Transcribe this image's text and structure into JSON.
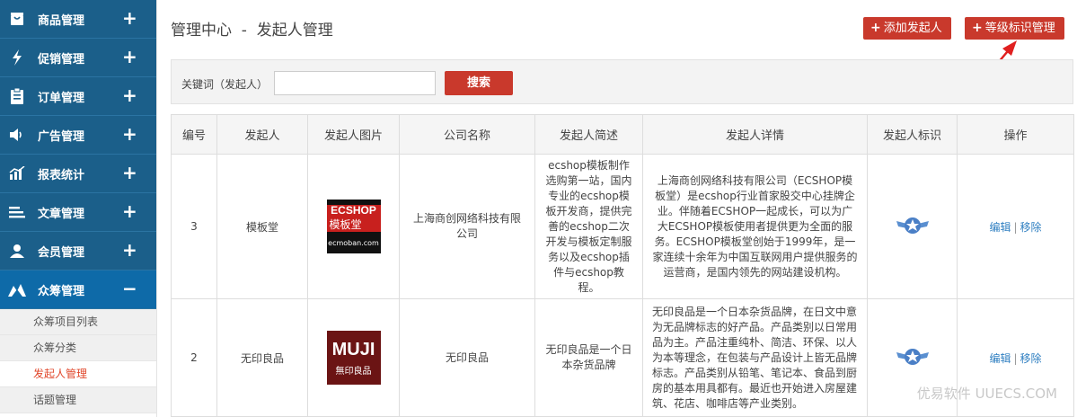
{
  "sidebar": {
    "items": [
      {
        "label": "商品管理",
        "icon": "shopping-bag-icon",
        "toggle": "+"
      },
      {
        "label": "促销管理",
        "icon": "lightning-icon",
        "toggle": "+"
      },
      {
        "label": "订单管理",
        "icon": "clipboard-icon",
        "toggle": "+"
      },
      {
        "label": "广告管理",
        "icon": "speaker-icon",
        "toggle": "+"
      },
      {
        "label": "报表统计",
        "icon": "chart-icon",
        "toggle": "+"
      },
      {
        "label": "文章管理",
        "icon": "list-icon",
        "toggle": "+"
      },
      {
        "label": "会员管理",
        "icon": "user-icon",
        "toggle": "+"
      },
      {
        "label": "众筹管理",
        "icon": "crowdfunding-icon",
        "toggle": "−"
      }
    ],
    "sub_items": [
      {
        "label": "众筹项目列表"
      },
      {
        "label": "众筹分类"
      },
      {
        "label": "发起人管理"
      },
      {
        "label": "话题管理"
      }
    ]
  },
  "header": {
    "title": "管理中心  -  发起人管理",
    "add_btn": "添加发起人",
    "level_btn": "等级标识管理"
  },
  "search": {
    "label": "关键词（发起人）",
    "value": "",
    "placeholder": "",
    "button": "搜索"
  },
  "table": {
    "headers": [
      "编号",
      "发起人",
      "发起人图片",
      "公司名称",
      "发起人简述",
      "发起人详情",
      "发起人标识",
      "操作"
    ],
    "rows": [
      {
        "id": "3",
        "name": "模板堂",
        "logo_top": "ECSHOP",
        "logo_mid": "模板堂",
        "logo_bot": "ecmoban.com",
        "company": "上海商创网络科技有限公司",
        "brief": "ecshop模板制作选购第一站，国内专业的ecshop模板开发商，提供完善的ecshop二次开发与模板定制服务以及ecshop插件与ecshop教程。",
        "detail": "上海商创网络科技有限公司（ECSHOP模板堂）是ecshop行业首家股交中心挂牌企业。伴随着ECSHOP一起成长，可以为广大ECSHOP模板使用者提供更为全面的服务。ECSHOP模板堂创始于1999年，是一家连续十余年为中国互联网用户提供服务的运营商，是国内领先的网站建设机构。",
        "edit": "编辑",
        "remove": "移除"
      },
      {
        "id": "2",
        "name": "无印良品",
        "logo_top": "MUJI",
        "logo_mid": "無印良品",
        "logo_bot": "",
        "company": "无印良品",
        "brief": "无印良品是一个日本杂货品牌",
        "detail": "无印良品是一个日本杂货品牌，在日文中意为无品牌标志的好产品。产品类别以日常用品为主。产品注重纯朴、简洁、环保、以人为本等理念，在包装与产品设计上皆无品牌标志。产品类别从铅笔、笔记本、食品到厨房的基本用具都有。最近也开始进入房屋建筑、花店、咖啡店等产业类别。",
        "edit": "编辑",
        "remove": "移除"
      }
    ]
  },
  "watermark": "优易软件 UUECS.COM",
  "colors": {
    "sidebar": "#1b5f8a",
    "accent_red": "#c9392c",
    "link": "#2f7fc1",
    "active_sub": "#e0462a"
  }
}
